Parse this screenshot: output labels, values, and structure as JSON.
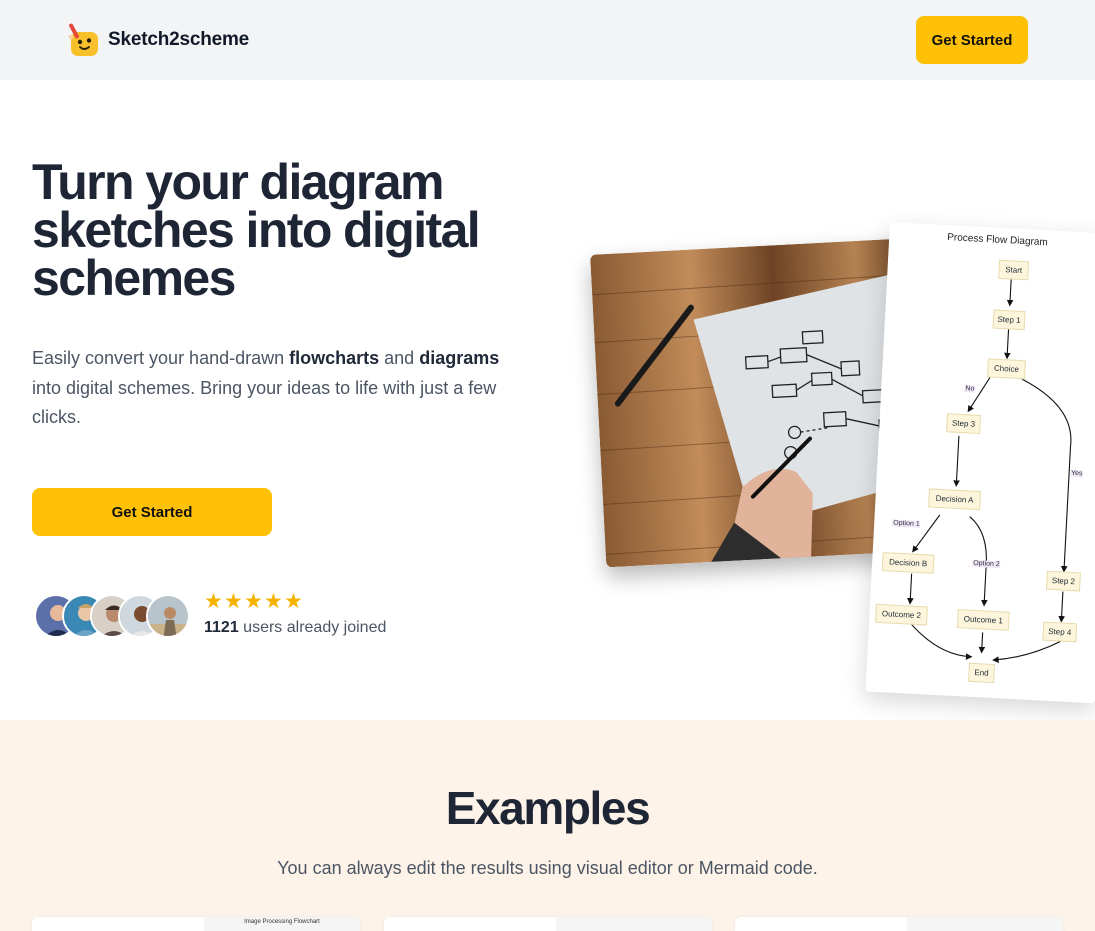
{
  "nav": {
    "brand": "Sketch2scheme",
    "cta": "Get Started",
    "logo_icon": "sticky-note-pencil-icon"
  },
  "hero": {
    "title": "Turn your diagram sketches into digital schemes",
    "subtitle_part1": "Easily convert your hand-drawn ",
    "subtitle_bold1": "flowcharts",
    "subtitle_part2": " and ",
    "subtitle_bold2": "diagrams",
    "subtitle_part3": " into digital schemes. Bring your ideas to life with just a few clicks.",
    "cta": "Get Started",
    "rating_stars": 5,
    "users_count": "1121",
    "users_text": " users already joined"
  },
  "diagram": {
    "title": "Process Flow Diagram",
    "nodes": {
      "start": "Start",
      "step1": "Step 1",
      "choice": "Choice",
      "step3": "Step 3",
      "decisionA": "Decision A",
      "decisionB": "Decision B",
      "step2": "Step 2",
      "outcome2": "Outcome 2",
      "outcome1": "Outcome 1",
      "step4": "Step 4",
      "end": "End"
    },
    "edges": {
      "no": "No",
      "yes": "Yes",
      "option1": "Option 1",
      "option2": "Option 2"
    }
  },
  "examples": {
    "title": "Examples",
    "subtitle": "You can always edit the results using visual editor or Mermaid code.",
    "card1_caption": "Image Processing Flowchart"
  },
  "colors": {
    "accent": "#ffc105",
    "nav_bg": "#f3f4f6",
    "examples_bg": "#fdf3e8",
    "heading": "#1e2535",
    "node_fill": "#fdf6dc",
    "edge_label_fill": "#f3e8f8"
  }
}
